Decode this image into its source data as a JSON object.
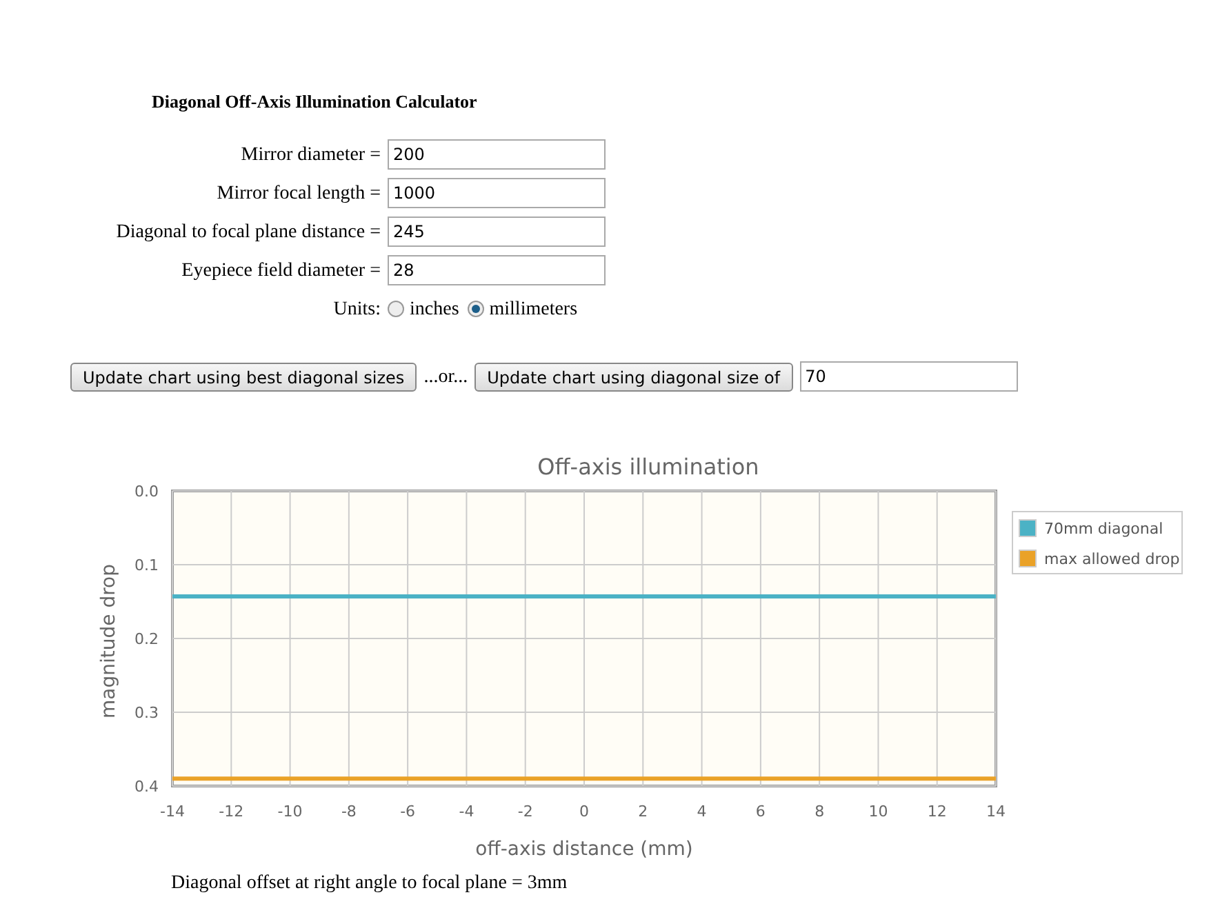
{
  "title": "Diagonal Off-Axis Illumination Calculator",
  "fields": [
    {
      "label": "Mirror diameter =",
      "value": "200"
    },
    {
      "label": "Mirror focal length =",
      "value": "1000"
    },
    {
      "label": "Diagonal to focal plane distance =",
      "value": "245"
    },
    {
      "label": "Eyepiece field diameter =",
      "value": "28"
    }
  ],
  "units": {
    "label": "Units:",
    "options": [
      {
        "label": "inches",
        "selected": false
      },
      {
        "label": "millimeters",
        "selected": true
      }
    ]
  },
  "actions": {
    "best_button": "Update chart using best diagonal sizes",
    "or_text": "...or...",
    "size_button": "Update chart using diagonal size of",
    "size_value": "70"
  },
  "chart": {
    "chart_data": {
      "type": "line",
      "title": "Off-axis illumination",
      "xlabel": "off-axis distance (mm)",
      "ylabel": "magnitude drop",
      "x": [
        -14,
        -12,
        -10,
        -8,
        -6,
        -4,
        -2,
        0,
        2,
        4,
        6,
        8,
        10,
        12,
        14
      ],
      "series": [
        {
          "name": "70mm diagonal",
          "color": "#4bb2c5",
          "values": [
            0.143,
            0.143,
            0.143,
            0.143,
            0.143,
            0.143,
            0.143,
            0.143,
            0.143,
            0.143,
            0.143,
            0.143,
            0.143,
            0.143,
            0.143
          ]
        },
        {
          "name": "max allowed drop",
          "color": "#eaa228",
          "values": [
            0.39,
            0.39,
            0.39,
            0.39,
            0.39,
            0.39,
            0.39,
            0.39,
            0.39,
            0.39,
            0.39,
            0.39,
            0.39,
            0.39,
            0.39
          ]
        }
      ],
      "grid": true,
      "legend": true,
      "xlim": [
        -14,
        14
      ],
      "ylim": [
        0.4,
        0.0
      ],
      "xticks": [
        -14,
        -12,
        -10,
        -8,
        -6,
        -4,
        -2,
        0,
        2,
        4,
        6,
        8,
        10,
        12,
        14
      ],
      "yticks": [
        {
          "value": 0,
          "label": "0.0"
        },
        {
          "value": 0.1,
          "label": "0.1"
        },
        {
          "value": 0.2,
          "label": "0.2"
        },
        {
          "value": 0.3,
          "label": "0.3"
        },
        {
          "value": 0.4,
          "label": "0.4"
        }
      ]
    }
  },
  "result": "Diagonal offset at right angle to focal plane = 3mm"
}
